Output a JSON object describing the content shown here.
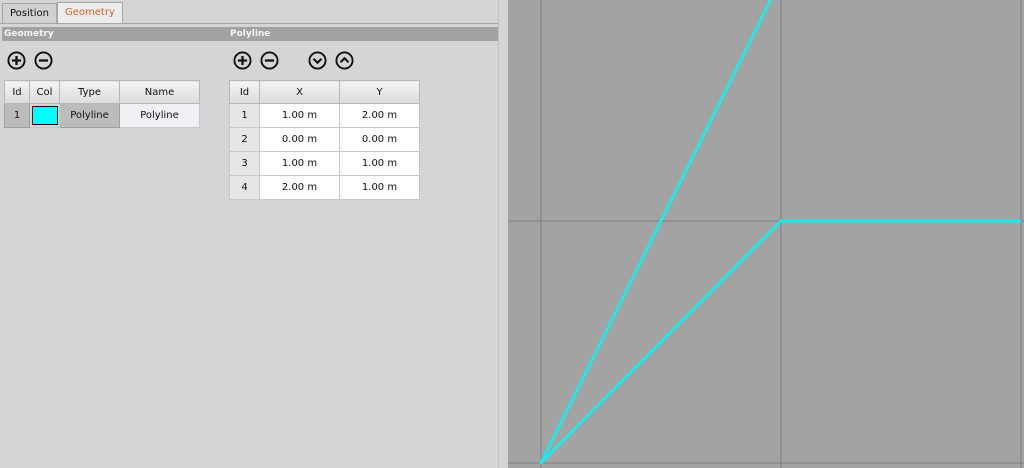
{
  "tabs": [
    {
      "label": "Position",
      "active": false
    },
    {
      "label": "Geometry",
      "active": true
    }
  ],
  "geometry_panel": {
    "header": "Geometry",
    "columns": [
      "Id",
      "Col",
      "Type",
      "Name"
    ],
    "rows": [
      {
        "id": "1",
        "color": "#00ffff",
        "type": "Polyline",
        "name": "Polyline"
      }
    ]
  },
  "polyline_panel": {
    "header": "Polyline",
    "columns": [
      "Id",
      "X",
      "Y"
    ],
    "rows": [
      {
        "id": "1",
        "x": "1.00 m",
        "y": "2.00 m"
      },
      {
        "id": "2",
        "x": "0.00 m",
        "y": "0.00 m"
      },
      {
        "id": "3",
        "x": "1.00 m",
        "y": "1.00 m"
      },
      {
        "id": "4",
        "x": "2.00 m",
        "y": "1.00 m"
      }
    ]
  },
  "icons": {
    "add": "plus-circle-icon",
    "remove": "minus-circle-icon",
    "move_down": "chevron-down-circle-icon",
    "move_up": "chevron-up-circle-icon"
  },
  "viewport": {
    "background": "#a3a3a3",
    "grid_color": "#7f7f7f",
    "polyline_color": "#1fe8e8",
    "polyline_points": [
      [
        1,
        2
      ],
      [
        0,
        0
      ],
      [
        1,
        1
      ],
      [
        2,
        1
      ]
    ]
  }
}
